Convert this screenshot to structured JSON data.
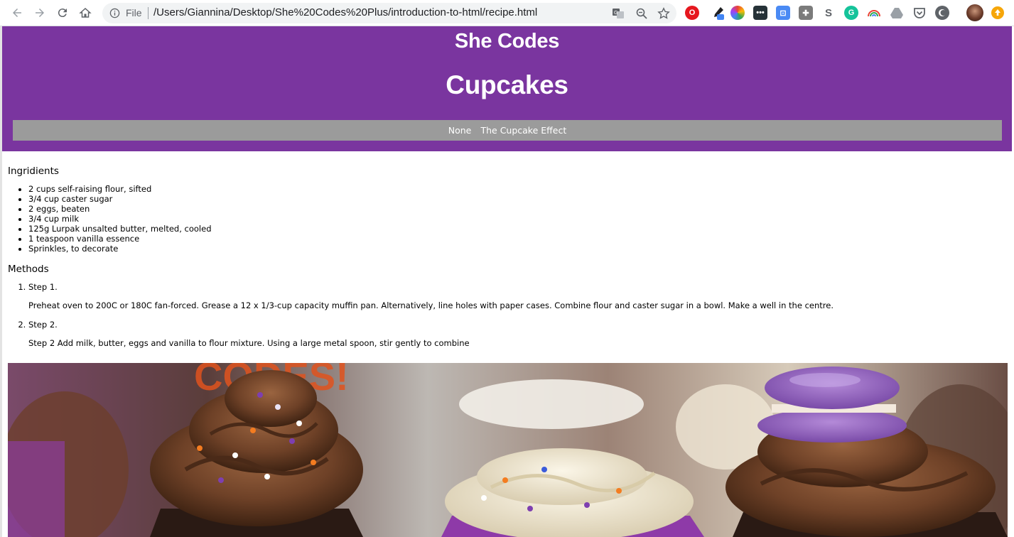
{
  "browser": {
    "file_label": "File",
    "url": "/Users/Giannina/Desktop/She%20Codes%20Plus/introduction-to-html/recipe.html",
    "extensions": [
      "opera-icon",
      "eyedropper-icon",
      "colorwheel-icon",
      "dots-icon",
      "translate-ext-icon",
      "puzzle-icon",
      "skype-icon",
      "grammarly-icon",
      "rainbow-icon",
      "drive-icon",
      "pocket-icon",
      "circle-icon",
      "profile-avatar",
      "update-icon"
    ],
    "colors": {
      "toolbar": "#ffffff",
      "omnibox": "#f1f3f4"
    }
  },
  "header": {
    "brand": "She Codes",
    "title": "Cupcakes",
    "nav": [
      "None",
      "The Cupcake Effect"
    ],
    "colors": {
      "banner": "#7a359f",
      "navbar": "#9b9b9b",
      "text": "#ffffff"
    }
  },
  "ingredients": {
    "heading": "Ingridients",
    "items": [
      "2 cups self-raising flour, sifted",
      "3/4 cup caster sugar",
      "2 eggs, beaten",
      "3/4 cup milk",
      "125g Lurpak unsalted butter, melted, cooled",
      "1 teaspoon vanilla essence",
      "Sprinkles, to decorate"
    ]
  },
  "methods": {
    "heading": "Methods",
    "steps": [
      {
        "title": "Step 1.",
        "text": "Preheat oven to 200C or 180C fan-forced. Grease a 12 x 1/3-cup capacity muffin pan. Alternatively, line holes with paper cases. Combine flour and caster sugar in a bowl. Make a well in the centre."
      },
      {
        "title": "Step 2.",
        "text": "Step 2 Add milk, butter, eggs and vanilla to flour mixture. Using a large metal spoon, stir gently to combine"
      }
    ]
  },
  "image": {
    "subject": "cupcakes-photo"
  }
}
